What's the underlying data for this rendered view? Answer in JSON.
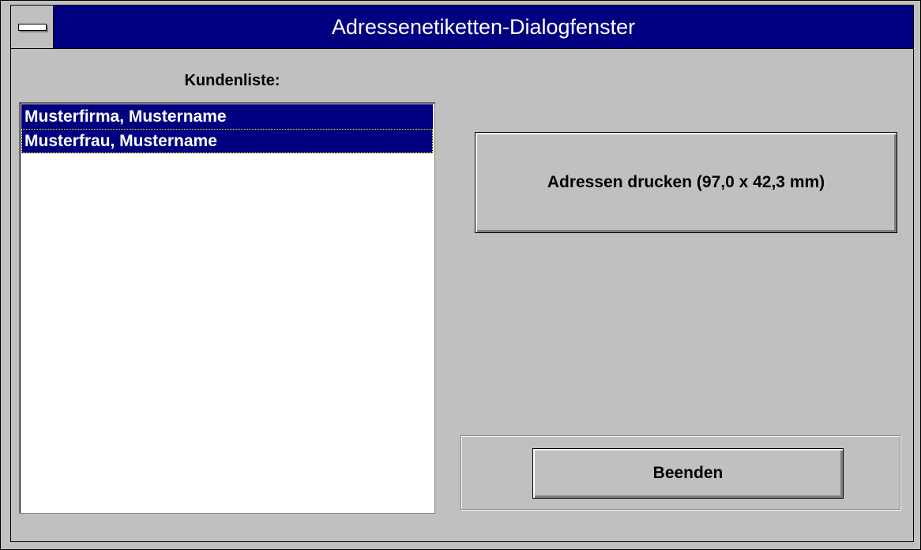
{
  "window": {
    "title": "Adressenetiketten-Dialogfenster",
    "colors": {
      "titlebar": "#000080",
      "face": "#c0c0c0",
      "selection": "#000080"
    }
  },
  "customers": {
    "label": "Kundenliste:",
    "items": [
      {
        "label": "Musterfirma, Mustername",
        "selected": true
      },
      {
        "label": "Musterfrau, Mustername",
        "selected": true,
        "focused": true
      }
    ]
  },
  "actions": {
    "print_label": "Adressen drucken (97,0 x 42,3 mm)",
    "exit_label": "Beenden"
  },
  "icons": {
    "system_menu": "system-menu-icon"
  }
}
